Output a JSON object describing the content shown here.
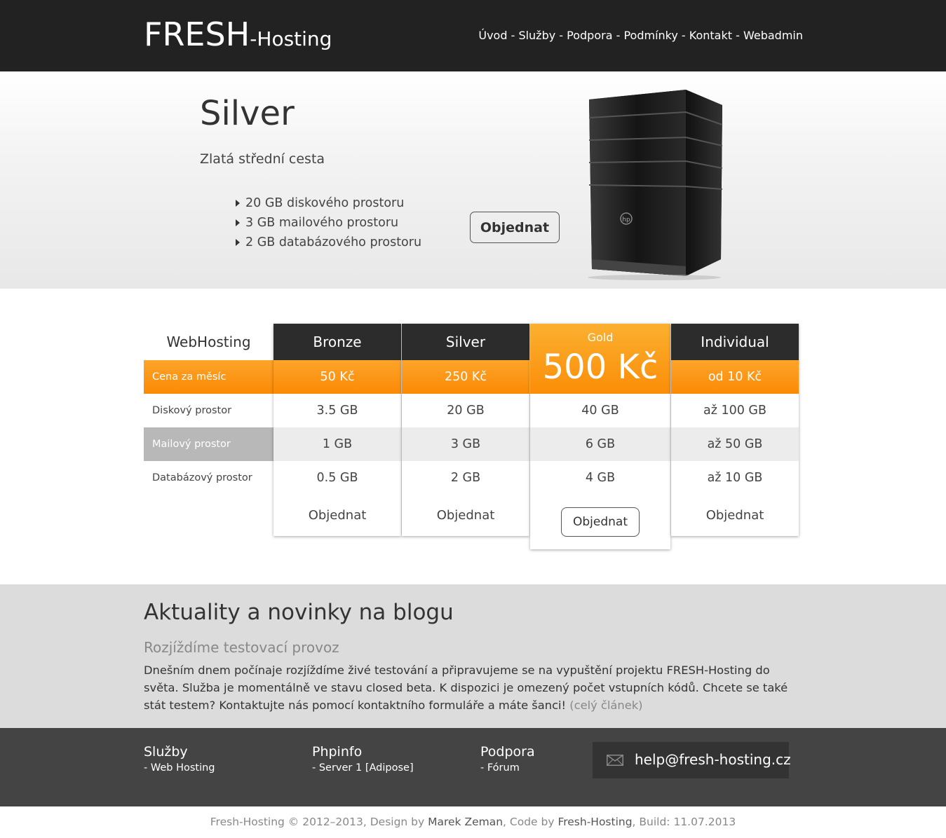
{
  "header": {
    "logo_main": "FRESH",
    "logo_sub": "-Hosting",
    "nav": [
      "Úvod",
      "Služby",
      "Podpora",
      "Podmínky",
      "Kontakt",
      "Webadmin"
    ],
    "nav_sep": " - "
  },
  "hero": {
    "title": "Silver",
    "subtitle": "Zlatá střední cesta",
    "features": [
      "20 GB diskového prostoru",
      "3 GB mailového prostoru",
      "2 GB databázového prostoru"
    ],
    "button": "Objednat",
    "server_logo": "hp"
  },
  "pricing": {
    "label": "WebHosting",
    "rows": [
      "Cena za měsíc",
      "Diskový prostor",
      "Mailový prostor",
      "Databázový prostor"
    ],
    "plans": [
      {
        "name": "Bronze",
        "price": "50 Kč",
        "disk": "3.5 GB",
        "mail": "1 GB",
        "db": "0.5 GB",
        "order": "Objednat"
      },
      {
        "name": "Silver",
        "price": "250 Kč",
        "disk": "20 GB",
        "mail": "3 GB",
        "db": "2 GB",
        "order": "Objednat"
      },
      {
        "name": "Gold",
        "price": "500 Kč",
        "disk": "40 GB",
        "mail": "6 GB",
        "db": "4 GB",
        "order": "Objednat"
      },
      {
        "name": "Individual",
        "price": "od 10 Kč",
        "disk": "až 100 GB",
        "mail": "až 50 GB",
        "db": "až 10 GB",
        "order": "Objednat"
      }
    ],
    "accent": "#fb8d08"
  },
  "blog": {
    "heading": "Aktuality a novinky na blogu",
    "post_title": "Rozjíždíme testovací provoz",
    "post_text": "Dnešním dnem počínaje rozjíždíme živé testování a připravujeme se na vypuštění projektu FRESH-Hosting do světa. Služba je momentálně ve stavu closed beta. K dispozici je omezený počet vstupních kódů. Chcete se také stát testem? Kontaktujte nás pomocí kontaktního formuláře a máte šanci!",
    "read_more": "(celý článek)"
  },
  "footer": {
    "columns": [
      {
        "title": "Služby",
        "link": "- Web Hosting"
      },
      {
        "title": "Phpinfo",
        "link": "- Server 1 [Adipose]"
      },
      {
        "title": "Podpora",
        "link": "- Fórum"
      }
    ],
    "email": "help@fresh-hosting.cz",
    "email_icon": "envelope-icon"
  },
  "copyright": {
    "part1": "Fresh-Hosting © 2012–2013, Design by ",
    "designer": "Marek Zeman",
    "part2": ", Code by ",
    "coder": "Fresh-Hosting",
    "part3": ", Build: 11.07.2013"
  }
}
